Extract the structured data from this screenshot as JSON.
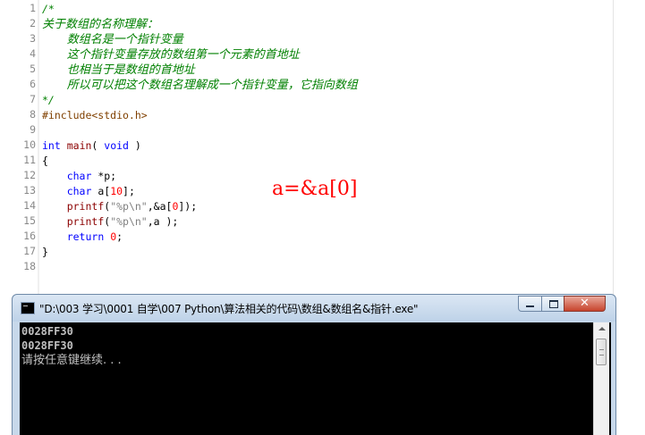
{
  "editor": {
    "lines": [
      {
        "n": "1",
        "tokens": [
          {
            "t": "/*",
            "c": "comment"
          }
        ]
      },
      {
        "n": "2",
        "tokens": [
          {
            "t": "关于数组的名称理解：",
            "c": "comment-cjk"
          }
        ]
      },
      {
        "n": "3",
        "tokens": [
          {
            "t": "    ",
            "c": "plain"
          },
          {
            "t": "数组名是一个指针变量",
            "c": "comment-cjk"
          }
        ]
      },
      {
        "n": "4",
        "tokens": [
          {
            "t": "    ",
            "c": "plain"
          },
          {
            "t": "这个指针变量存放的数组第一个元素的首地址",
            "c": "comment-cjk"
          }
        ]
      },
      {
        "n": "5",
        "tokens": [
          {
            "t": "    ",
            "c": "plain"
          },
          {
            "t": "也相当于是数组的首地址",
            "c": "comment-cjk"
          }
        ]
      },
      {
        "n": "6",
        "tokens": [
          {
            "t": "    ",
            "c": "plain"
          },
          {
            "t": "所以可以把这个数组名理解成一个指针变量，它指向数组",
            "c": "comment-cjk"
          }
        ]
      },
      {
        "n": "7",
        "tokens": [
          {
            "t": "*/",
            "c": "comment"
          }
        ]
      },
      {
        "n": "8",
        "tokens": [
          {
            "t": "#include<stdio.h>",
            "c": "pp"
          }
        ]
      },
      {
        "n": "9",
        "tokens": []
      },
      {
        "n": "10",
        "tokens": [
          {
            "t": "int",
            "c": "kw"
          },
          {
            "t": " ",
            "c": "plain"
          },
          {
            "t": "main",
            "c": "fn"
          },
          {
            "t": "( ",
            "c": "plain"
          },
          {
            "t": "void",
            "c": "kw"
          },
          {
            "t": " )",
            "c": "plain"
          }
        ]
      },
      {
        "n": "11",
        "tokens": [
          {
            "t": "{",
            "c": "plain"
          }
        ]
      },
      {
        "n": "12",
        "tokens": [
          {
            "t": "    ",
            "c": "plain"
          },
          {
            "t": "char",
            "c": "kw"
          },
          {
            "t": " *p;",
            "c": "plain"
          }
        ]
      },
      {
        "n": "13",
        "tokens": [
          {
            "t": "    ",
            "c": "plain"
          },
          {
            "t": "char",
            "c": "kw"
          },
          {
            "t": " a[",
            "c": "plain"
          },
          {
            "t": "10",
            "c": "num"
          },
          {
            "t": "];",
            "c": "plain"
          }
        ]
      },
      {
        "n": "14",
        "tokens": [
          {
            "t": "    ",
            "c": "plain"
          },
          {
            "t": "printf",
            "c": "fn"
          },
          {
            "t": "(",
            "c": "plain"
          },
          {
            "t": "\"%p\\n\"",
            "c": "str"
          },
          {
            "t": ",&a[",
            "c": "plain"
          },
          {
            "t": "0",
            "c": "num"
          },
          {
            "t": "]);",
            "c": "plain"
          }
        ]
      },
      {
        "n": "15",
        "tokens": [
          {
            "t": "    ",
            "c": "plain"
          },
          {
            "t": "printf",
            "c": "fn"
          },
          {
            "t": "(",
            "c": "plain"
          },
          {
            "t": "\"%p\\n\"",
            "c": "str"
          },
          {
            "t": ",a );",
            "c": "plain"
          }
        ]
      },
      {
        "n": "16",
        "tokens": [
          {
            "t": "    ",
            "c": "plain"
          },
          {
            "t": "return",
            "c": "kw"
          },
          {
            "t": " ",
            "c": "plain"
          },
          {
            "t": "0",
            "c": "num"
          },
          {
            "t": ";",
            "c": "plain"
          }
        ]
      },
      {
        "n": "17",
        "tokens": [
          {
            "t": "}",
            "c": "plain"
          }
        ]
      },
      {
        "n": "18",
        "tokens": []
      }
    ],
    "annotation": "a=&a[0]"
  },
  "console": {
    "title": "\"D:\\003 学习\\0001 自学\\007 Python\\算法相关的代码\\数组&数组名&指针.exe\"",
    "lines": [
      "0028FF30",
      "0028FF30",
      "请按任意键继续. . ."
    ],
    "close_glyph": "✕"
  },
  "colors": {
    "comment": "#008000",
    "keyword": "#0000ff",
    "function": "#8b0000",
    "number": "#ff0000",
    "annotation": "#ff0000",
    "console_bg": "#000000",
    "console_text": "#c0c0c0"
  },
  "icons": {
    "app": "console-app-icon",
    "minimize": "minimize-icon",
    "maximize": "maximize-icon",
    "close": "close-icon"
  }
}
